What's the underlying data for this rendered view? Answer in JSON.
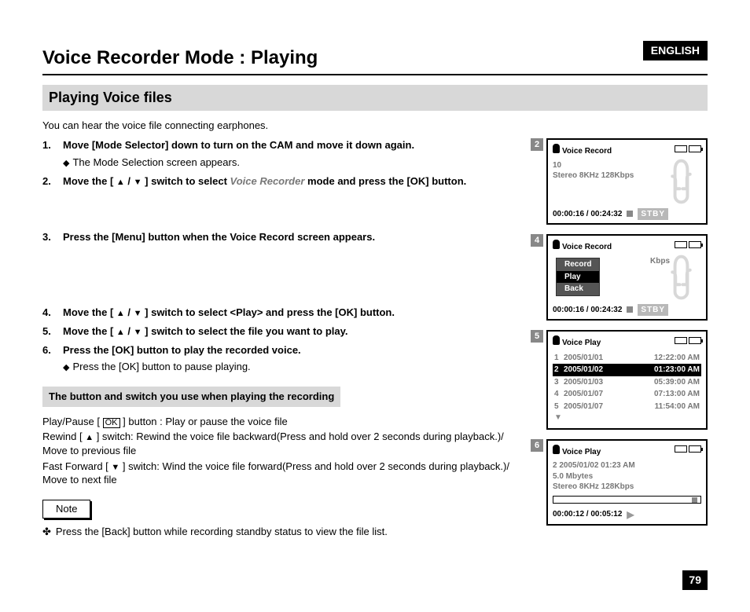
{
  "language_badge": "ENGLISH",
  "page_number": "79",
  "title": "Voice Recorder Mode : Playing",
  "subtitle": "Playing Voice files",
  "intro": "You can hear the voice file connecting earphones.",
  "steps": [
    {
      "num": "1.",
      "main": "Move [Mode Selector] down to turn on the CAM and move it down again.",
      "sub": "The Mode Selection screen appears."
    },
    {
      "num": "2.",
      "main_pre": "Move the [ ",
      "main_post": " ] switch to select ",
      "mode_name": "Voice Recorder",
      "main_tail": " mode and press the [OK] button."
    },
    {
      "num": "3.",
      "main": "Press the [Menu] button when the Voice Record screen appears."
    },
    {
      "num": "4.",
      "main_pre": "Move the [ ",
      "main_post": " ] switch to select <Play> and press the [OK] button."
    },
    {
      "num": "5.",
      "main_pre": "Move the [ ",
      "main_post": " ] switch to select the file you want to play."
    },
    {
      "num": "6.",
      "main": "Press the [OK] button to play the recorded voice.",
      "sub": "Press the [OK] button to pause playing."
    }
  ],
  "subheading": "The button and switch you use when playing the recording",
  "controls": {
    "play_pause": "Play/Pause [",
    "play_pause_after": "] button : Play or pause the voice file",
    "rewind": "Rewind [ ",
    "rewind_after": " ] switch: Rewind the voice file backward(Press and hold over 2 seconds during playback.)/ Move to previous file",
    "ff": "Fast Forward [ ",
    "ff_after": " ] switch: Wind the voice file forward(Press and hold over 2 seconds during playback.)/ Move to next file"
  },
  "note_label": "Note",
  "note_text": "Press the [Back] button while recording standby status to view the file list.",
  "screens": {
    "s2": {
      "tag": "2",
      "title": "Voice Record",
      "count": "10",
      "format": "Stereo  8KHz  128Kbps",
      "time": "00:00:16 / 00:24:32",
      "status": "STBY"
    },
    "s4": {
      "tag": "4",
      "title": "Voice Record",
      "format_tail": "Kbps",
      "menu": [
        "Record",
        "Play",
        "Back"
      ],
      "menu_selected": 1,
      "time": "00:00:16 / 00:24:32",
      "status": "STBY"
    },
    "s5": {
      "tag": "5",
      "title": "Voice Play",
      "files": [
        {
          "idx": "1",
          "date": "2005/01/01",
          "time": "12:22:00 AM"
        },
        {
          "idx": "2",
          "date": "2005/01/02",
          "time": "01:23:00 AM"
        },
        {
          "idx": "3",
          "date": "2005/01/03",
          "time": "05:39:00 AM"
        },
        {
          "idx": "4",
          "date": "2005/01/07",
          "time": "07:13:00 AM"
        },
        {
          "idx": "5",
          "date": "2005/01/07",
          "time": "11:54:00 AM"
        }
      ],
      "selected": 1
    },
    "s6": {
      "tag": "6",
      "title": "Voice Play",
      "line1": "2  2005/01/02  01:23 AM",
      "line2": "5.0 Mbytes",
      "line3": "Stereo  8KHz  128Kbps",
      "time": "00:00:12 / 00:05:12"
    }
  }
}
